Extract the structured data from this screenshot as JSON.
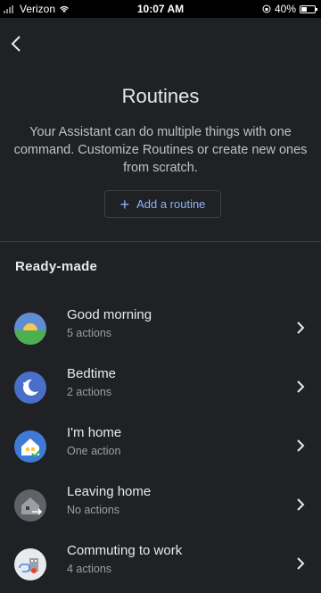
{
  "status": {
    "carrier": "Verizon",
    "time": "10:07 AM",
    "battery": "40%"
  },
  "header": {
    "title": "Routines",
    "description": "Your Assistant can do multiple things with one command. Customize Routines or create new ones from scratch.",
    "add_button_icon": "+",
    "add_button_label": "Add a routine"
  },
  "section_title": "Ready-made",
  "routines": [
    {
      "name": "Good morning",
      "actions": "5 actions",
      "icon": "sunrise-icon"
    },
    {
      "name": "Bedtime",
      "actions": "2 actions",
      "icon": "moon-icon"
    },
    {
      "name": "I'm home",
      "actions": "One action",
      "icon": "home-check-icon"
    },
    {
      "name": "Leaving home",
      "actions": "No actions",
      "icon": "home-leave-icon"
    },
    {
      "name": "Commuting to work",
      "actions": "4 actions",
      "icon": "commute-icon"
    }
  ],
  "colors": {
    "accent": "#8ab4f8",
    "background": "#202124"
  }
}
